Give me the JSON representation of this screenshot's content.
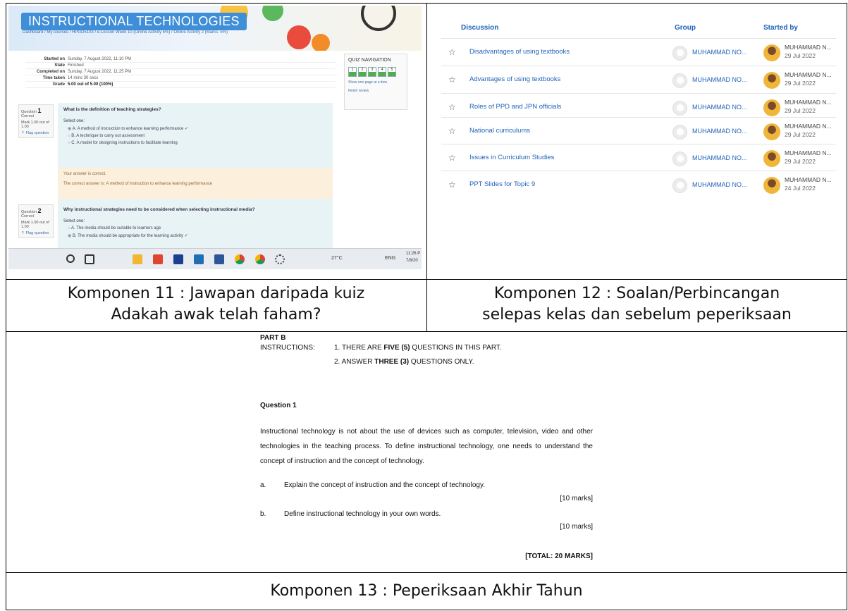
{
  "panel1": {
    "banner_title": "INSTRUCTIONAL TECHNOLOGIES",
    "breadcrumb": "Dashboard / My courses / HPGD5103 / e-Lesson Week 10 (Online Activity 5%) / Online Activity 2 (Marks: 5%)",
    "summary": [
      {
        "key": "Started on",
        "value": "Sunday, 7 August 2022, 11:10 PM"
      },
      {
        "key": "State",
        "value": "Finished"
      },
      {
        "key": "Completed on",
        "value": "Sunday, 7 August 2022, 11:25 PM"
      },
      {
        "key": "Time taken",
        "value": "14 mins 30 secs"
      },
      {
        "key": "Grade",
        "value": "5.00 out of 5.00 (100%)"
      }
    ],
    "questions": [
      {
        "label": "Question",
        "num": "1",
        "status": "Correct",
        "mark": "Mark 1.00 out of 1.00",
        "flag": "Flag question",
        "text": "What is the definition of teaching strategies?",
        "select": "Select one:",
        "options": [
          "A.  A method of instruction to enhance learning performance",
          "B.  A technique to carry out assessment",
          "C.  A model for designing instructions to facilitate learning"
        ]
      },
      {
        "label": "Question",
        "num": "2",
        "status": "Correct",
        "mark": "Mark 1.00 out of 1.00",
        "flag": "Flag question",
        "text": "Why instructional strategies need to be considered when selecting instructional media?",
        "select": "Select one:",
        "options": [
          "A.  The media should be suitable to learners age",
          "B.  The media should be appropriate for the learning activity"
        ]
      }
    ],
    "feedback": {
      "line1": "Your answer is correct.",
      "line2": "The correct answer is: A method of instruction to enhance learning performance"
    },
    "nav": {
      "title": "QUIZ NAVIGATION",
      "boxes": [
        "1",
        "2",
        "3",
        "4",
        "5"
      ],
      "show_one": "Show one page at a time",
      "finish": "Finish review"
    },
    "taskbar": {
      "weather": "27°C",
      "lang": "ENG",
      "time": "11:26 P",
      "date": "7/8/20"
    },
    "colors": {
      "accent": "#3f8ed8",
      "correct": "#4cae4c",
      "feedback_bg": "#fcefdc"
    }
  },
  "panel2": {
    "headers": {
      "discussion": "Discussion",
      "group": "Group",
      "started_by": "Started by"
    },
    "rows": [
      {
        "title": "Disadvantages of using textbooks",
        "group": "MUHAMMAD NO...",
        "user": "MUHAMMAD N...",
        "date": "29 Jul 2022"
      },
      {
        "title": "Advantages of using textbooks",
        "group": "MUHAMMAD NO...",
        "user": "MUHAMMAD N...",
        "date": "29 Jul 2022"
      },
      {
        "title": "Roles of PPD and JPN officials",
        "group": "MUHAMMAD NO...",
        "user": "MUHAMMAD N...",
        "date": "29 Jul 2022"
      },
      {
        "title": "National curriculums",
        "group": "MUHAMMAD NO...",
        "user": "MUHAMMAD N...",
        "date": "29 Jul 2022"
      },
      {
        "title": "Issues in Curriculum Studies",
        "group": "MUHAMMAD NO...",
        "user": "MUHAMMAD N...",
        "date": "29 Jul 2022"
      },
      {
        "title": "PPT Slides for Topic 9",
        "group": "MUHAMMAD NO...",
        "user": "MUHAMMAD N...",
        "date": "24 Jul 2022"
      }
    ]
  },
  "panel3": {
    "part": "PART B",
    "instructions_label": "INSTRUCTIONS:",
    "instruction1_pre": "1. THERE ARE ",
    "instruction1_bold": "FIVE (5)",
    "instruction1_post": " QUESTIONS IN THIS PART.",
    "instruction2_pre": "2. ANSWER ",
    "instruction2_bold": "THREE (3)",
    "instruction2_post": " QUESTIONS ONLY.",
    "question_title": "Question 1",
    "paragraph": "Instructional technology is not about the use of devices such as computer, television, video and other technologies in the teaching process. To define instructional technology, one needs to understand the concept of instruction and the concept of technology.",
    "item_a_letter": "a.",
    "item_a": "Explain the concept of instruction and the concept of technology.",
    "marks_a": "[10 marks]",
    "item_b_letter": "b.",
    "item_b": "Define instructional technology in your own words.",
    "marks_b": "[10 marks]",
    "total": "[TOTAL: 20 MARKS]"
  },
  "captions": {
    "c11_line1": "Komponen 11 : Jawapan daripada kuiz",
    "c11_line2": "Adakah awak telah faham?",
    "c12_line1": "Komponen 12 : Soalan/Perbincangan",
    "c12_line2": "selepas kelas dan sebelum peperiksaan",
    "c13": "Komponen 13 : Peperiksaan Akhir Tahun"
  }
}
